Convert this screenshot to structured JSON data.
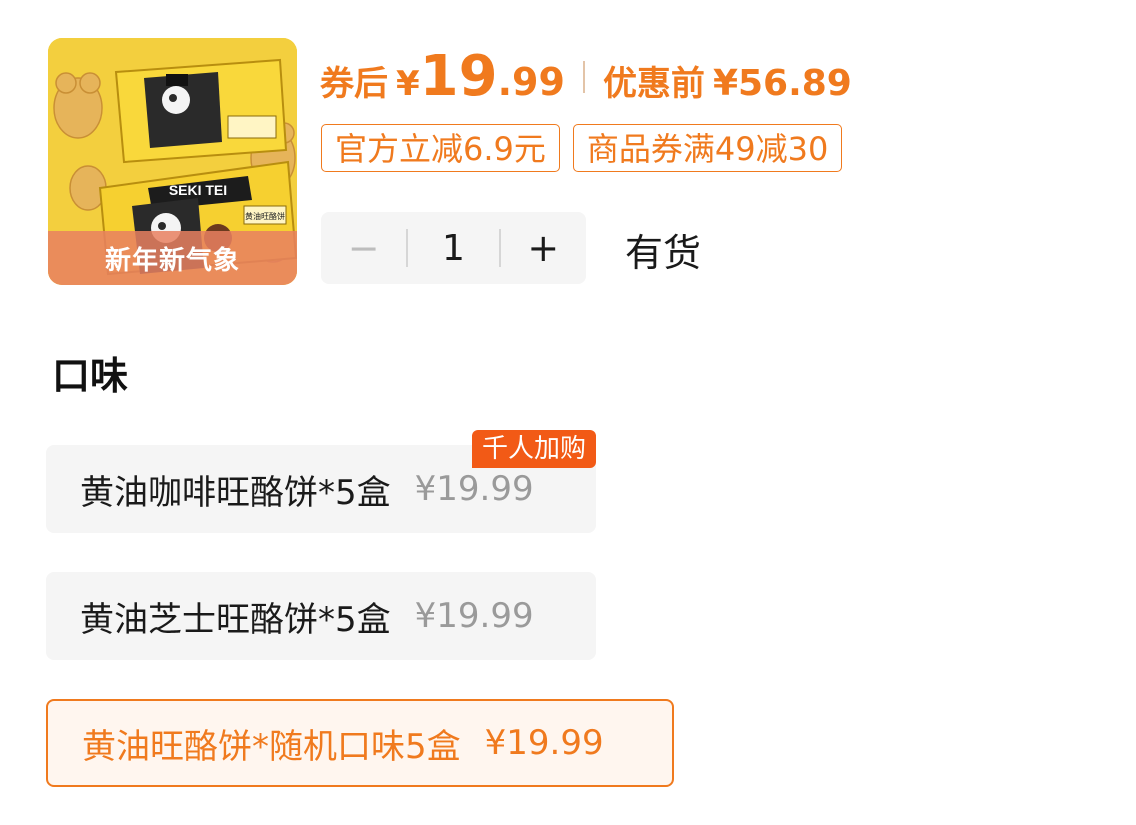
{
  "product": {
    "thumbnail_banner": "新年新气象",
    "thumbnail_box_text": "SEKI TEI",
    "thumbnail_box_label": "黄油旺酪饼"
  },
  "price": {
    "after_coupon_label": "券后",
    "currency": "¥",
    "after_coupon_int": "19",
    "after_coupon_dec": ".99",
    "before_label": "优惠前",
    "before_value": "¥56.89"
  },
  "promotions": [
    {
      "text": "官方立减6.9元"
    },
    {
      "text": "商品券满49减30"
    }
  ],
  "quantity": {
    "minus": "−",
    "value": "1",
    "plus": "+",
    "stock": "有货"
  },
  "flavor": {
    "title": "口味",
    "options": [
      {
        "name": "黄油咖啡旺酪饼*5盒",
        "price": "¥19.99",
        "badge": "千人加购",
        "selected": false
      },
      {
        "name": "黄油芝士旺酪饼*5盒",
        "price": "¥19.99",
        "selected": false
      },
      {
        "name": "黄油旺酪饼*随机口味5盒",
        "price": "¥19.99",
        "selected": true
      }
    ]
  },
  "colors": {
    "accent": "#f07a1e",
    "badge": "#f25a16",
    "thumb_bg": "#f3cf3e"
  }
}
